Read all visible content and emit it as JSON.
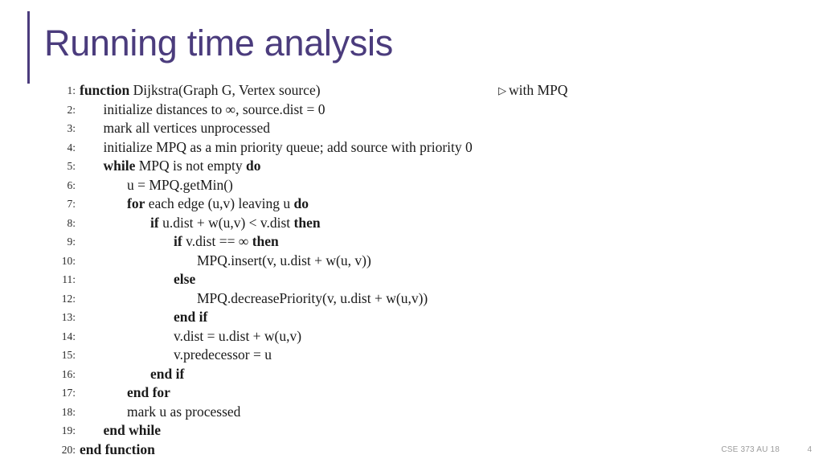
{
  "slide": {
    "title": "Running time analysis",
    "accent_color": "#4b3c7d",
    "background_color": "#ffffff"
  },
  "algorithm": {
    "comment_marker": "▷",
    "lines": [
      {
        "no": "1:",
        "indent": 0,
        "text": "function Dijkstra(Graph G, Vertex source)",
        "comment": "with MPQ"
      },
      {
        "no": "2:",
        "indent": 1,
        "text": "initialize distances to ∞, source.dist = 0"
      },
      {
        "no": "3:",
        "indent": 1,
        "text": "mark all vertices unprocessed"
      },
      {
        "no": "4:",
        "indent": 1,
        "text": "initialize MPQ as a min priority queue; add source with priority 0"
      },
      {
        "no": "5:",
        "indent": 1,
        "text": "while MPQ is not empty do"
      },
      {
        "no": "6:",
        "indent": 2,
        "text": "u = MPQ.getMin()"
      },
      {
        "no": "7:",
        "indent": 2,
        "text": "for each edge (u,v) leaving u do"
      },
      {
        "no": "8:",
        "indent": 3,
        "text": "if u.dist + w(u,v) < v.dist then"
      },
      {
        "no": "9:",
        "indent": 4,
        "text": "if v.dist == ∞ then"
      },
      {
        "no": "10:",
        "indent": 5,
        "text": "MPQ.insert(v, u.dist + w(u, v))"
      },
      {
        "no": "11:",
        "indent": 4,
        "text": "else"
      },
      {
        "no": "12:",
        "indent": 5,
        "text": "MPQ.decreasePriority(v, u.dist + w(u,v))"
      },
      {
        "no": "13:",
        "indent": 4,
        "text": "end if"
      },
      {
        "no": "14:",
        "indent": 4,
        "text": "v.dist = u.dist + w(u,v)"
      },
      {
        "no": "15:",
        "indent": 4,
        "text": "v.predecessor = u"
      },
      {
        "no": "16:",
        "indent": 3,
        "text": "end if"
      },
      {
        "no": "17:",
        "indent": 2,
        "text": "end for"
      },
      {
        "no": "18:",
        "indent": 2,
        "text": "mark u as processed"
      },
      {
        "no": "19:",
        "indent": 1,
        "text": "end while"
      },
      {
        "no": "20:",
        "indent": 0,
        "text": "end function"
      }
    ]
  },
  "footer": {
    "course": "CSE 373 AU 18",
    "page": "4"
  }
}
